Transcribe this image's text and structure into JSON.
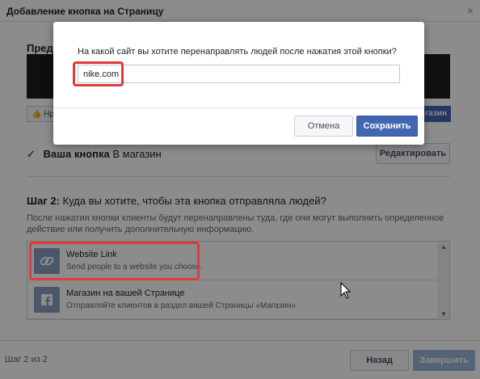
{
  "dialog": {
    "title": "Добавление кнопка на Страницу",
    "close_glyph": "×"
  },
  "preview": {
    "title_partial": "Предп",
    "like_label": "Нр",
    "shop_label": "газин"
  },
  "your_button": {
    "check": "✓",
    "label": "Ваша кнопка",
    "value": "В магазин",
    "edit_label": "Редактировать"
  },
  "step": {
    "prefix": "Шаг 2:",
    "question": "Куда вы хотите, чтобы эта кнопка отправляла людей?",
    "description": "После нажатия кнопки клиенты будут перенаправлены туда, где они могут выполнить определенное действие или получить дополнительную информацию."
  },
  "options": [
    {
      "icon": "link-icon",
      "title": "Website Link",
      "subtitle": "Send people to a website you choose."
    },
    {
      "icon": "facebook-icon",
      "title": "Магазин на вашей Странице",
      "subtitle": "Отправляйте клиентов в раздел вашей Страницы «Магазин»"
    }
  ],
  "footer": {
    "step_counter": "Шаг 2 из 2",
    "back_label": "Назад",
    "finish_label": "Завершить"
  },
  "modal": {
    "question": "На какой сайт вы хотите перенаправлять людей после нажатия этой кнопки?",
    "input_value": "nike.com",
    "cancel_label": "Отмена",
    "save_label": "Сохранить"
  },
  "colors": {
    "accent": "#4267b2",
    "highlight": "#e03a3a",
    "overlay": "rgba(0,0,0,0.45)"
  }
}
